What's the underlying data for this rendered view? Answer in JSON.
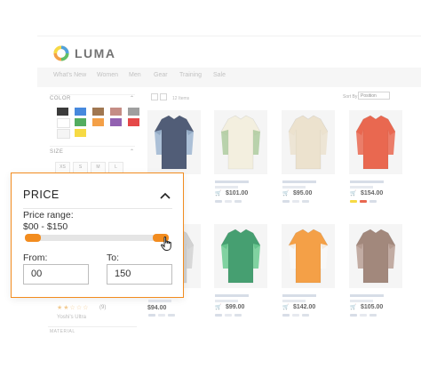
{
  "store": {
    "brand": "LUMA",
    "nav": [
      "What's New",
      "Women",
      "Men",
      "Gear",
      "Training",
      "Sale"
    ],
    "sidebar": {
      "color_label": "COLOR",
      "colors": [
        "#111111",
        "#1f6fd6",
        "#8b5a2b",
        "#b9746b",
        "#8a8a8a",
        "#ffffff",
        "#2e9b3e",
        "#f28c1f",
        "#7b3fa0",
        "#e02020",
        "#f3f3f3",
        "#f5d21b"
      ],
      "size_label": "SIZE",
      "sizes": [
        "XS",
        "S",
        "M",
        "L"
      ]
    },
    "toolbar": {
      "count": "12 Items",
      "sort_label": "Sort By",
      "sort_value": "Position"
    },
    "products": [
      {
        "price": "",
        "color": "#2b3a5a",
        "accent": "#8aa7c8"
      },
      {
        "price": "$101.00",
        "color": "#f1ecd8",
        "accent": "#9cc08a"
      },
      {
        "price": "$95.00",
        "color": "#e8dcc4",
        "accent": "#e8dcc4"
      },
      {
        "price": "$154.00",
        "color": "#e4472a",
        "accent": "#e4472a"
      },
      {
        "price": "",
        "color": "#c9c9c9",
        "accent": "#c9c9c9"
      },
      {
        "price": "$99.00",
        "color": "#1e8a52",
        "accent": "#4cbf7a"
      },
      {
        "price": "$142.00",
        "color": "#f28c1f",
        "accent": "#f7f7f7"
      },
      {
        "price": "$105.00",
        "color": "#8e6e60",
        "accent": "#a98a7c"
      }
    ],
    "price_bottom_left": "$94.00"
  },
  "price_filter": {
    "title": "PRICE",
    "range_label": "Price range:",
    "range_value": "$00 - $150",
    "slider_min_fraction": 0.0,
    "slider_max_fraction": 1.0,
    "from_label": "From:",
    "to_label": "To:",
    "from_value": "00",
    "to_value": "150",
    "accent_color": "#f28c1f"
  },
  "rating": {
    "stars": "★★☆☆☆",
    "count": "(9)",
    "text": "Yoshi's Ultra",
    "material_label": "MATERIAL"
  }
}
